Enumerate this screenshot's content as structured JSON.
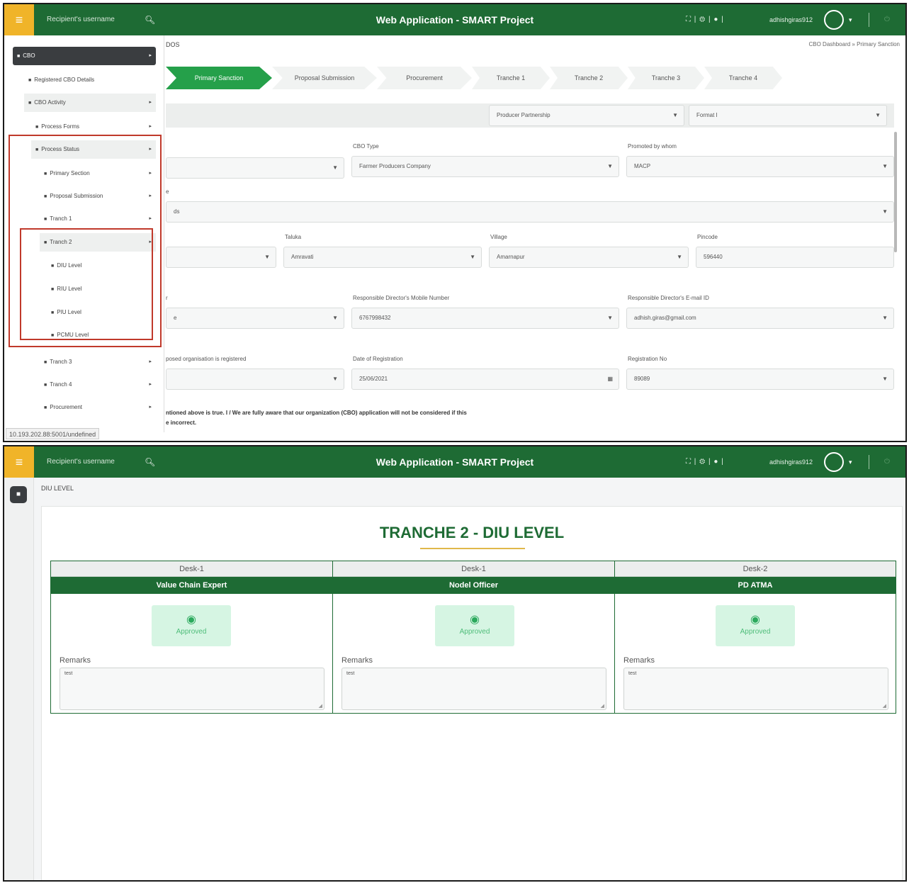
{
  "app": {
    "title": "Web Application - SMART Project",
    "search_placeholder": "Recipient's username",
    "username": "adhishgiras912",
    "toolbar_icons": [
      "fullscreen-icon",
      "settings-icon",
      "notification-icon"
    ],
    "brand_color": "#1e6b34",
    "menu_color": "#f0b429"
  },
  "screen1": {
    "breadcrumb_left": "DOS",
    "breadcrumb_right": "CBO Dashboard  »  Primary Sanction",
    "steps": [
      "Primary Sanction",
      "Proposal Submission",
      "Procurement",
      "Tranche 1",
      "Tranche 2",
      "Tranche 3",
      "Tranche 4"
    ],
    "active_step": 0,
    "filters": {
      "scheme": "Producer Partnership",
      "format": "Format I"
    },
    "form": {
      "cbo_type_label": "CBO Type",
      "cbo_type_value": "Farmer Producers Company",
      "promoted_label": "Promoted by whom",
      "promoted_value": "MACP",
      "row2_label": "e",
      "row2_value": "ds",
      "taluka_label": "Taluka",
      "taluka_value": "Amravati",
      "village_label": "Village",
      "village_value": "Amarnapur",
      "pincode_label": "Pincode",
      "pincode_value": "596440",
      "director_prefix_label": "r",
      "director_prefix_value": "e",
      "mobile_label": "Responsible Director's Mobile Number",
      "mobile_value": "6767998432",
      "email_label": "Responsible Director's E-mail ID",
      "email_value": "adhish.giras@gmail.com",
      "registered_label": "posed organisation is registered",
      "registration_date_label": "Date of Registration",
      "registration_date_value": "25/06/2021",
      "registration_no_label": "Registration No",
      "registration_no_value": "89089"
    },
    "declaration_line1": "ntioned above is true. I / We are fully aware that our organization (CBO) application will not be considered if this",
    "declaration_line2": "e incorrect.",
    "status_url": "10.193.202.88:5001/undefined",
    "sidebar": {
      "root": "CBO",
      "items": [
        {
          "label": "Registered CBO Details"
        },
        {
          "label": "CBO Activity"
        },
        {
          "label": "Process Forms"
        },
        {
          "label": "Process Status"
        },
        {
          "label": "Primary Section"
        },
        {
          "label": "Proposal Submission"
        },
        {
          "label": "Tranch 1"
        },
        {
          "label": "Tranch 2"
        },
        {
          "label": "DIU Level"
        },
        {
          "label": "RIU Level"
        },
        {
          "label": "PIU Level"
        },
        {
          "label": "PCMU Level"
        },
        {
          "label": "Tranch 3"
        },
        {
          "label": "Tranch 4"
        },
        {
          "label": "Procurement"
        }
      ]
    }
  },
  "screen2": {
    "page_title": "DIU LEVEL",
    "heading": "TRANCHE 2 - DIU LEVEL",
    "desks": [
      {
        "desk": "Desk-1",
        "role": "Value Chain Expert",
        "status": "Approved",
        "remarks_label": "Remarks",
        "remarks": "test"
      },
      {
        "desk": "Desk-1",
        "role": "Nodel Officer",
        "status": "Approved",
        "remarks_label": "Remarks",
        "remarks": "test"
      },
      {
        "desk": "Desk-2",
        "role": "PD ATMA",
        "status": "Approved",
        "remarks_label": "Remarks",
        "remarks": "test"
      }
    ]
  }
}
